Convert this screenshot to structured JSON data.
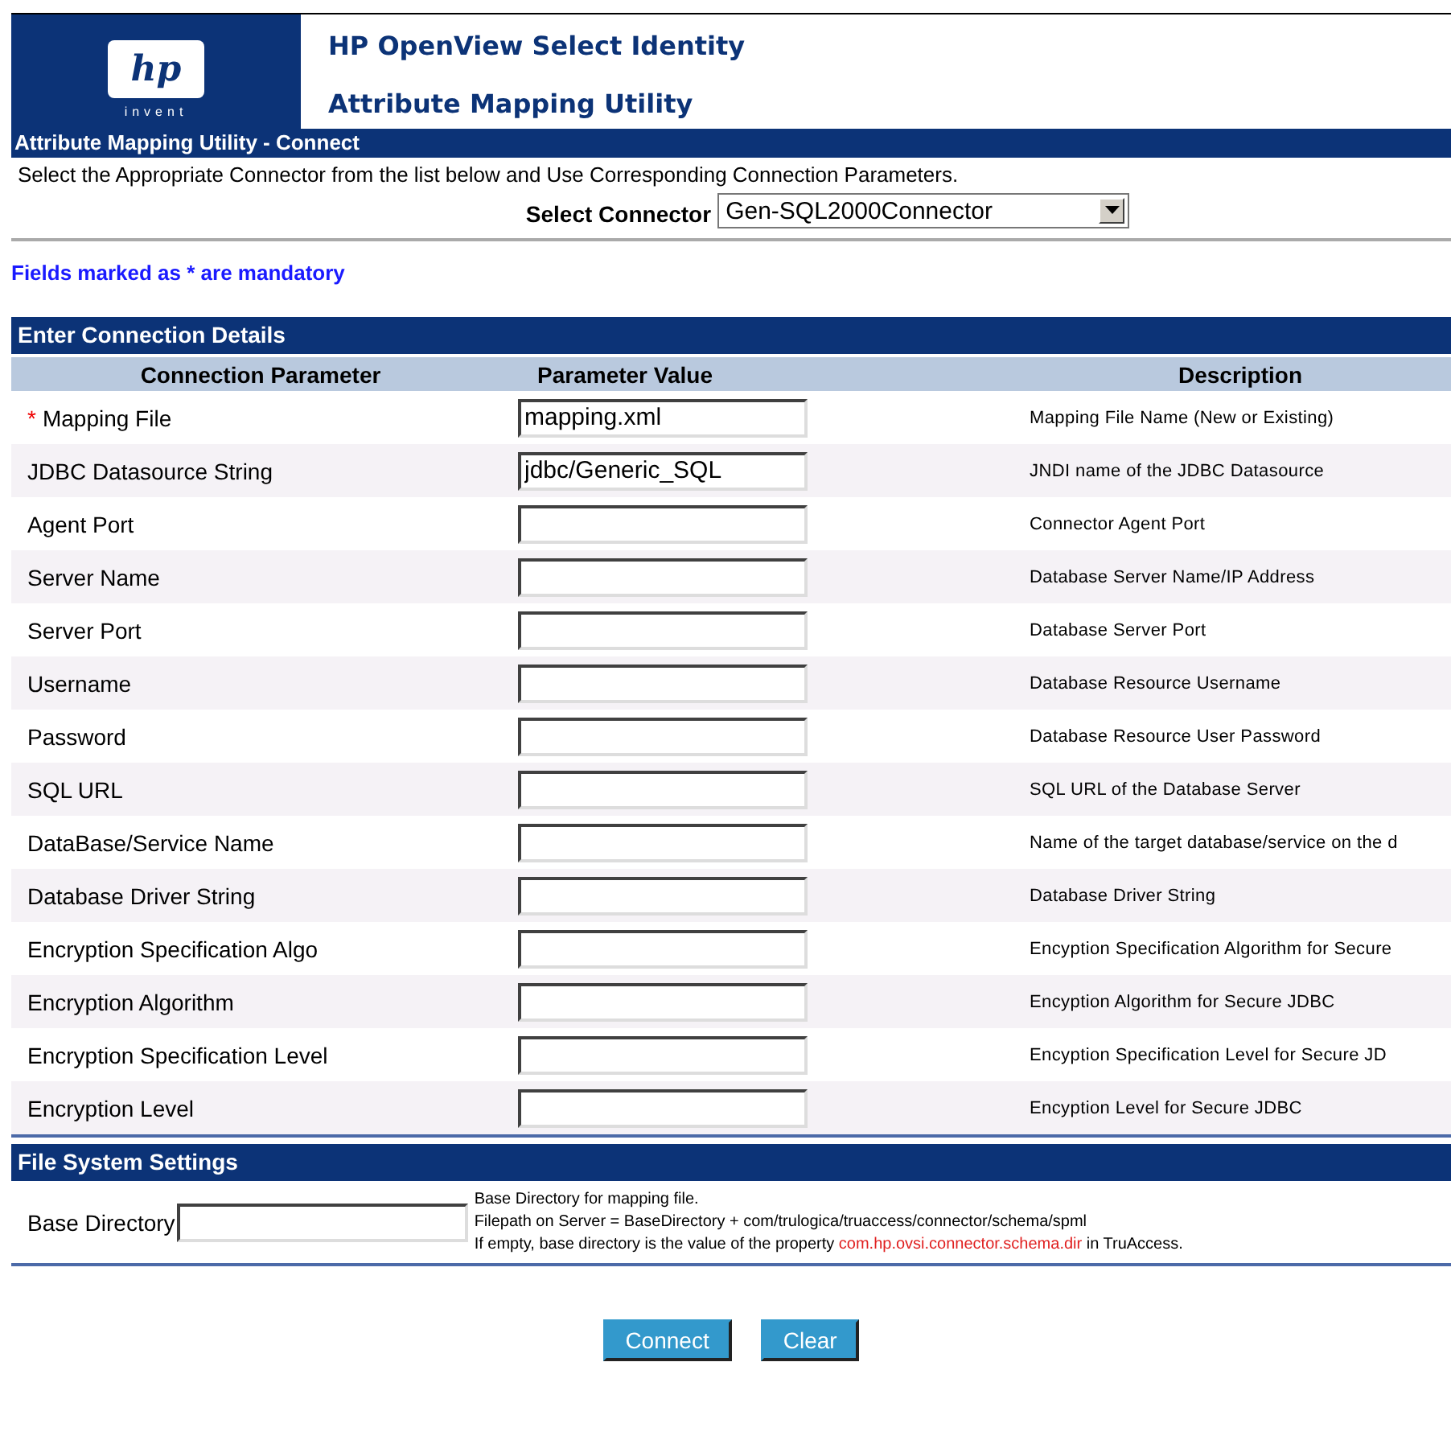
{
  "header": {
    "logo": {
      "mark": "hp",
      "tagline": "invent"
    },
    "product": "HP OpenView Select Identity",
    "utility": "Attribute Mapping Utility"
  },
  "page_title": "Attribute Mapping Utility - Connect",
  "instruction": "Select the Appropriate Connector from the list below and Use Corresponding Connection Parameters.",
  "connector": {
    "label": "Select Connector",
    "value": "Gen-SQL2000Connector"
  },
  "mandatory_note": "Fields marked as * are mandatory",
  "connection": {
    "title": "Enter Connection Details",
    "columns": [
      "Connection Parameter",
      "Parameter Value",
      "Description"
    ],
    "rows": [
      {
        "required_mark": "*",
        "parameter": "Mapping File",
        "value": "mapping.xml",
        "description": "Mapping File Name (New or Existing)"
      },
      {
        "parameter": "JDBC Datasource String",
        "value": "jdbc/Generic_SQL",
        "description": "JNDI name of the JDBC Datasource"
      },
      {
        "parameter": "Agent Port",
        "description": "Connector Agent Port"
      },
      {
        "parameter": "Server Name",
        "description": "Database Server Name/IP Address"
      },
      {
        "parameter": "Server Port",
        "description": "Database Server Port"
      },
      {
        "parameter": "Username",
        "description": "Database Resource Username"
      },
      {
        "parameter": "Password",
        "description": "Database Resource User Password"
      },
      {
        "parameter": "SQL URL",
        "description": "SQL URL of the Database Server"
      },
      {
        "parameter": "DataBase/Service Name",
        "description": "Name of the target database/service on the d"
      },
      {
        "parameter": "Database Driver String",
        "description": "Database Driver String"
      },
      {
        "parameter": "Encryption Specification Algo",
        "description": "Encyption Specification Algorithm for Secure"
      },
      {
        "parameter": "Encryption Algorithm",
        "description": "Encyption Algorithm for Secure JDBC"
      },
      {
        "parameter": "Encryption Specification Level",
        "description": "Encyption Specification Level for Secure JD"
      },
      {
        "parameter": "Encryption Level",
        "description": "Encyption Level for Secure JDBC"
      }
    ]
  },
  "file_system": {
    "title": "File System Settings",
    "label": "Base Directory",
    "help": [
      "Base Directory for mapping file.",
      "Filepath on Server = BaseDirectory + com/trulogica/truaccess/connector/schema/spml"
    ],
    "help_last": {
      "before": "If empty, base directory is the value of the property",
      "property": "com.hp.ovsi.connector.schema.dir",
      "after": "in TruAccess."
    }
  },
  "buttons": [
    "Connect",
    "Clear"
  ]
}
